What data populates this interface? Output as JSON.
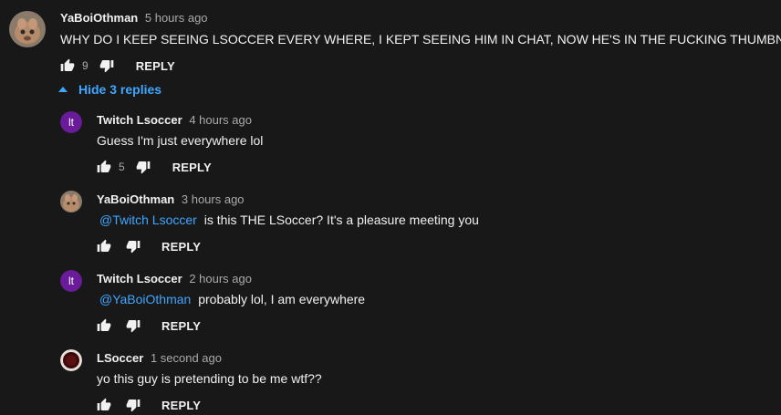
{
  "comments": [
    {
      "author": "YaBoiOthman",
      "time": "5 hours ago",
      "text": "WHY DO I KEEP SEEING LSOCCER EVERY WHERE, I KEPT SEEING HIM IN CHAT, NOW HE'S IN THE FUCKING THUMBNAIL",
      "likes": "9",
      "reply_label": "REPLY"
    }
  ],
  "replies_toggle": {
    "label": "Hide 3 replies"
  },
  "replies": [
    {
      "author": "Twitch Lsoccer",
      "initials": "lt",
      "time": "4 hours ago",
      "text": "Guess I'm just everywhere lol",
      "likes": "5",
      "reply_label": "REPLY"
    },
    {
      "author": "YaBoiOthman",
      "time": "3 hours ago",
      "mention": "@Twitch Lsoccer",
      "text": "is this THE LSoccer? It's a pleasure meeting you",
      "reply_label": "REPLY"
    },
    {
      "author": "Twitch Lsoccer",
      "initials": "lt",
      "time": "2 hours ago",
      "mention": "@YaBoiOthman",
      "text": "probably lol, I am everywhere",
      "reply_label": "REPLY"
    },
    {
      "author": "LSoccer",
      "time": "1 second ago",
      "text": "yo this guy is pretending to be me wtf??",
      "reply_label": "REPLY"
    }
  ],
  "colors": {
    "background": "#181818",
    "link": "#3ea6ff",
    "muted": "#aaaaaa",
    "avatar_purple": "#6a1b9a"
  },
  "icons": [
    "thumb-up-icon",
    "thumb-down-icon",
    "caret-up-icon"
  ]
}
